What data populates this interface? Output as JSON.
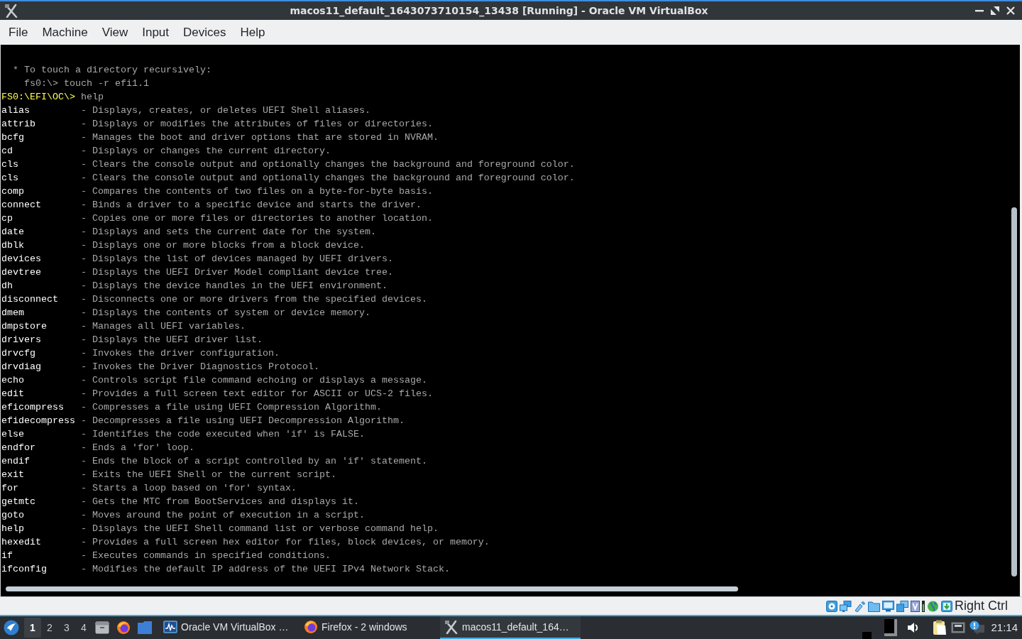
{
  "window": {
    "title": "macos11_default_1643073710154_13438 [Running] - Oracle VM VirtualBox"
  },
  "menu_bar": {
    "items": [
      "File",
      "Machine",
      "View",
      "Input",
      "Devices",
      "Help"
    ]
  },
  "console": {
    "lines": [
      {
        "kind": "note",
        "text": "* To touch a directory recursively:"
      },
      {
        "kind": "example",
        "text": "fs0:\\> touch -r efi1.1"
      },
      {
        "kind": "prompt",
        "prompt": "FS0:\\EFI\\OC\\>",
        "text": "help"
      }
    ],
    "commands": [
      {
        "name": "alias",
        "description": "- Displays, creates, or deletes UEFI Shell aliases."
      },
      {
        "name": "attrib",
        "description": "- Displays or modifies the attributes of files or directories."
      },
      {
        "name": "bcfg",
        "description": "- Manages the boot and driver options that are stored in NVRAM."
      },
      {
        "name": "cd",
        "description": "- Displays or changes the current directory."
      },
      {
        "name": "cls",
        "description": "- Clears the console output and optionally changes the background and foreground color."
      },
      {
        "name": "cls",
        "description": "- Clears the console output and optionally changes the background and foreground color."
      },
      {
        "name": "comp",
        "description": "- Compares the contents of two files on a byte-for-byte basis."
      },
      {
        "name": "connect",
        "description": "- Binds a driver to a specific device and starts the driver."
      },
      {
        "name": "cp",
        "description": "- Copies one or more files or directories to another location."
      },
      {
        "name": "date",
        "description": "- Displays and sets the current date for the system."
      },
      {
        "name": "dblk",
        "description": "- Displays one or more blocks from a block device."
      },
      {
        "name": "devices",
        "description": "- Displays the list of devices managed by UEFI drivers."
      },
      {
        "name": "devtree",
        "description": "- Displays the UEFI Driver Model compliant device tree."
      },
      {
        "name": "dh",
        "description": "- Displays the device handles in the UEFI environment."
      },
      {
        "name": "disconnect",
        "description": "- Disconnects one or more drivers from the specified devices."
      },
      {
        "name": "dmem",
        "description": "- Displays the contents of system or device memory."
      },
      {
        "name": "dmpstore",
        "description": "- Manages all UEFI variables."
      },
      {
        "name": "drivers",
        "description": "- Displays the UEFI driver list."
      },
      {
        "name": "drvcfg",
        "description": "- Invokes the driver configuration."
      },
      {
        "name": "drvdiag",
        "description": "- Invokes the Driver Diagnostics Protocol."
      },
      {
        "name": "echo",
        "description": "- Controls script file command echoing or displays a message."
      },
      {
        "name": "edit",
        "description": "- Provides a full screen text editor for ASCII or UCS-2 files."
      },
      {
        "name": "eficompress",
        "description": "- Compresses a file using UEFI Compression Algorithm."
      },
      {
        "name": "efidecompress",
        "description": "- Decompresses a file using UEFI Decompression Algorithm."
      },
      {
        "name": "else",
        "description": "- Identifies the code executed when 'if' is FALSE."
      },
      {
        "name": "endfor",
        "description": "- Ends a 'for' loop."
      },
      {
        "name": "endif",
        "description": "- Ends the block of a script controlled by an 'if' statement."
      },
      {
        "name": "exit",
        "description": "- Exits the UEFI Shell or the current script."
      },
      {
        "name": "for",
        "description": "- Starts a loop based on 'for' syntax."
      },
      {
        "name": "getmtc",
        "description": "- Gets the MTC from BootServices and displays it."
      },
      {
        "name": "goto",
        "description": "- Moves around the point of execution in a script."
      },
      {
        "name": "help",
        "description": "- Displays the UEFI Shell command list or verbose command help."
      },
      {
        "name": "hexedit",
        "description": "- Provides a full screen hex editor for files, block devices, or memory."
      },
      {
        "name": "if",
        "description": "- Executes commands in specified conditions."
      },
      {
        "name": "ifconfig",
        "description": "- Modifies the default IP address of the UEFI IPv4 Network Stack."
      }
    ]
  },
  "status_bar": {
    "host_key": "Right Ctrl"
  },
  "taskbar": {
    "desktops": [
      {
        "label": "1",
        "selected": true
      },
      {
        "label": "2",
        "selected": false
      },
      {
        "label": "3",
        "selected": false
      },
      {
        "label": "4",
        "selected": false
      }
    ],
    "tasks": [
      {
        "kind": "virtualbox",
        "label": "Oracle VM VirtualBox …",
        "selected": false
      },
      {
        "kind": "browser",
        "label": "Firefox - 2 windows",
        "selected": false
      },
      {
        "kind": "vm",
        "label": "macos11_default_164…",
        "selected": true
      }
    ],
    "clock": "21:14"
  }
}
